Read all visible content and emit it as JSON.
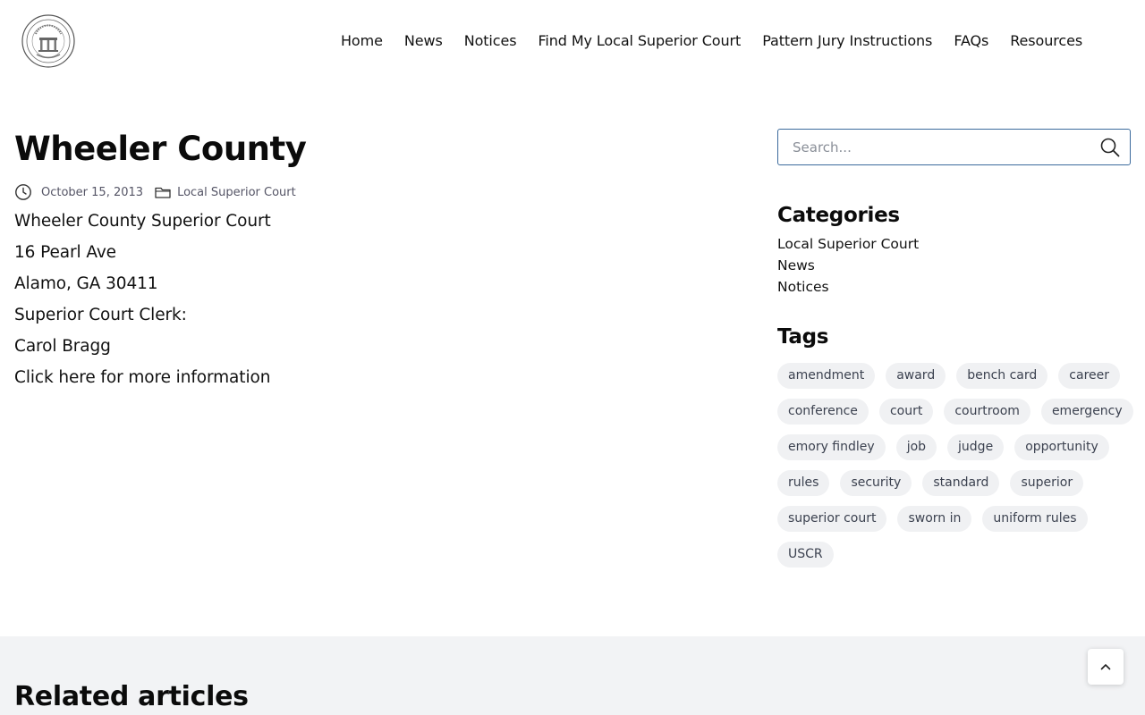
{
  "header": {
    "logo_icon": "georgia-state-seal-icon",
    "nav": [
      {
        "label": "Home"
      },
      {
        "label": "News"
      },
      {
        "label": "Notices"
      },
      {
        "label": "Find My Local Superior Court"
      },
      {
        "label": "Pattern Jury Instructions"
      },
      {
        "label": "FAQs"
      },
      {
        "label": "Resources"
      }
    ]
  },
  "article": {
    "title": "Wheeler County",
    "date": "October 15, 2013",
    "category": "Local Superior Court",
    "lines": [
      "Wheeler County Superior Court",
      "16 Pearl Ave",
      "Alamo, GA 30411",
      "Superior Court Clerk:",
      "Carol Bragg"
    ],
    "more_link": "Click here for more information"
  },
  "sidebar": {
    "search_placeholder": "Search...",
    "categories_title": "Categories",
    "categories": [
      "Local Superior Court",
      "News",
      "Notices"
    ],
    "tags_title": "Tags",
    "tags": [
      "amendment",
      "award",
      "bench card",
      "career",
      "conference",
      "court",
      "courtroom",
      "emergency",
      "emory findley",
      "job",
      "judge",
      "opportunity",
      "rules",
      "security",
      "standard",
      "superior",
      "superior court",
      "sworn in",
      "uniform rules",
      "USCR"
    ]
  },
  "related": {
    "title": "Related articles"
  },
  "colors": {
    "search_border": "#3b6a9c",
    "tag_bg": "#f0f1f3",
    "related_bg": "#f2f3f5"
  }
}
